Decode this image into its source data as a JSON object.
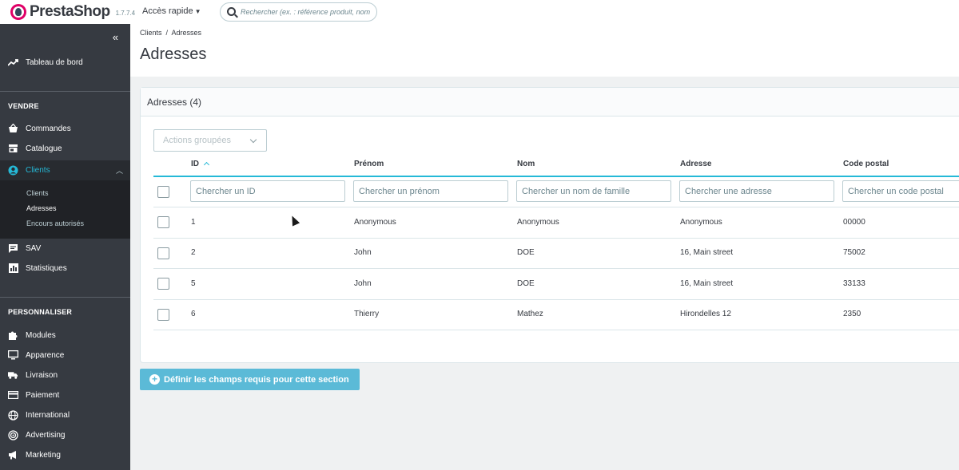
{
  "header": {
    "brand": "PrestaShop",
    "version": "1.7.7.4",
    "quick_access": "Accès rapide",
    "search_placeholder": "Rechercher (ex. : référence produit, nom"
  },
  "sidebar": {
    "collapse": "«",
    "dashboard": "Tableau de bord",
    "sections": {
      "sell": "VENDRE",
      "customize": "PERSONNALISER"
    },
    "sell_items": [
      {
        "label": "Commandes",
        "icon": "basket-icon"
      },
      {
        "label": "Catalogue",
        "icon": "store-icon"
      },
      {
        "label": "Clients",
        "icon": "account-icon"
      },
      {
        "label": "SAV",
        "icon": "chat-icon"
      },
      {
        "label": "Statistiques",
        "icon": "bar-chart-icon"
      }
    ],
    "clients_sub": [
      "Clients",
      "Adresses",
      "Encours autorisés"
    ],
    "customize_items": [
      {
        "label": "Modules",
        "icon": "puzzle-icon"
      },
      {
        "label": "Apparence",
        "icon": "monitor-icon"
      },
      {
        "label": "Livraison",
        "icon": "truck-icon"
      },
      {
        "label": "Paiement",
        "icon": "credit-card-icon"
      },
      {
        "label": "International",
        "icon": "globe-icon"
      },
      {
        "label": "Advertising",
        "icon": "target-icon"
      },
      {
        "label": "Marketing",
        "icon": "megaphone-icon"
      }
    ]
  },
  "page": {
    "breadcrumb": "Clients  /  Adresses",
    "title": "Adresses"
  },
  "panel": {
    "title": "Adresses (4)",
    "bulk_actions": "Actions groupées",
    "columns": [
      "ID",
      "Prénom",
      "Nom",
      "Adresse",
      "Code postal"
    ],
    "filters": [
      "Chercher un ID",
      "Chercher un prénom",
      "Chercher un nom de famille",
      "Chercher une adresse",
      "Chercher un code postal"
    ],
    "rows": [
      {
        "id": "1",
        "firstname": "Anonymous",
        "lastname": "Anonymous",
        "address": "Anonymous",
        "postcode": "00000"
      },
      {
        "id": "2",
        "firstname": "John",
        "lastname": "DOE",
        "address": "16, Main street",
        "postcode": "75002"
      },
      {
        "id": "5",
        "firstname": "John",
        "lastname": "DOE",
        "address": "16, Main street",
        "postcode": "33133"
      },
      {
        "id": "6",
        "firstname": "Thierry",
        "lastname": "Mathez",
        "address": "Hirondelles 12",
        "postcode": "2350"
      }
    ]
  },
  "required_fields_button": "Définir les champs requis pour cette section",
  "colors": {
    "accent": "#25b9d7",
    "sidebar_bg": "#363a41",
    "button_bg": "#5bbad7"
  }
}
